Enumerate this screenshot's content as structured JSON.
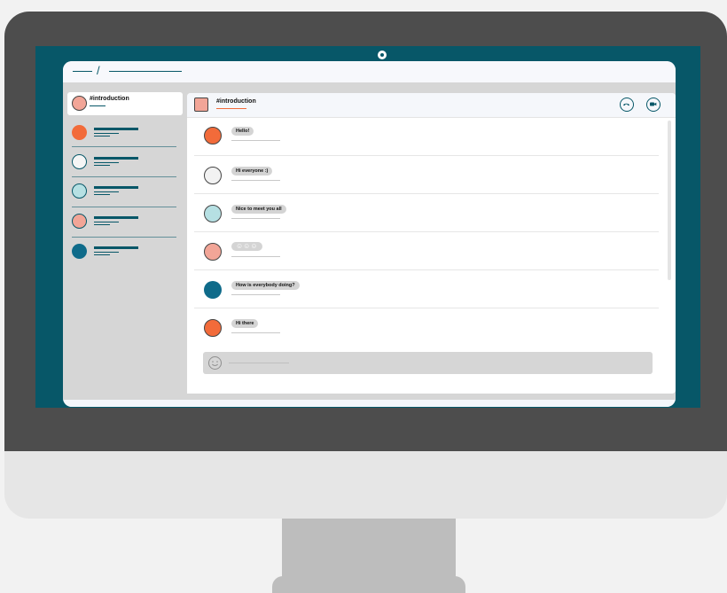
{
  "channel": {
    "name": "#introduction"
  },
  "sidebar": {
    "avatars": [
      {
        "color": "#f26b3a",
        "border": "#f26b3a"
      },
      {
        "color": "#f5f5f5",
        "border": "#075768"
      },
      {
        "color": "#b6e0e3",
        "border": "#075768"
      },
      {
        "color": "#f2a597",
        "border": "#075768"
      },
      {
        "color": "#0f6b8a",
        "border": "#0f6b8a"
      }
    ],
    "active_avatar_color": "#f2a597"
  },
  "chat": {
    "title": "#introduction",
    "actions": [
      "phone-icon",
      "video-icon"
    ],
    "messages": [
      {
        "text": "Hello!",
        "avatar_color": "#f26b3a"
      },
      {
        "text": "Hi everyone :)",
        "avatar_color": "#f2f2f2"
      },
      {
        "text": "Nice to meet you all",
        "avatar_color": "#b6e0e3"
      },
      {
        "text": "☺☺☺",
        "avatar_color": "#f2a597"
      },
      {
        "text": "How is everybody doing?",
        "avatar_color": "#0f6b8a"
      },
      {
        "text": "Hi there",
        "avatar_color": "#f26b3a"
      }
    ],
    "input_placeholder": ""
  },
  "colors": {
    "accent": "#075768",
    "orange": "#f26b3a",
    "salmon": "#f2a597",
    "mint": "#b6e0e3"
  }
}
